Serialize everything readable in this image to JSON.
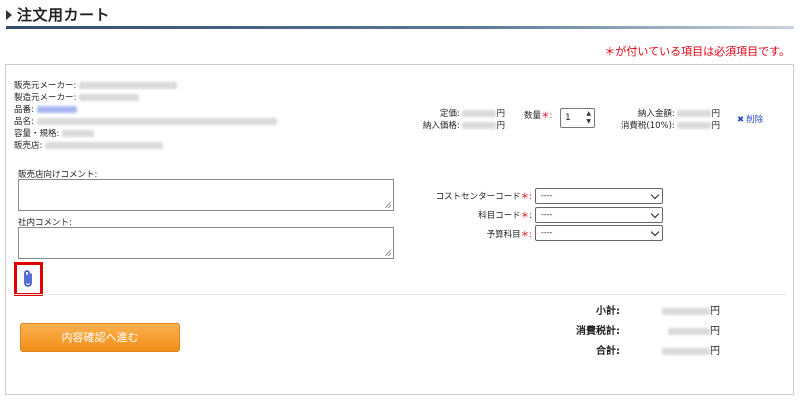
{
  "header": {
    "title": "注文用カート"
  },
  "required_note": "＊が付いている項目は必須項目です。",
  "product": {
    "seller_maker_label": "販売元メーカー:",
    "manufacturer_label": "製造元メーカー:",
    "part_number_label": "品番:",
    "product_name_label": "品名:",
    "capacity_spec_label": "容量・規格:",
    "store_label": "販売店:"
  },
  "pricing": {
    "list_price_label": "定価:",
    "delivery_price_label": "納入価格:",
    "currency_suffix": "円"
  },
  "quantity": {
    "label": "数量",
    "required_mark": "＊:",
    "value": "1"
  },
  "amounts": {
    "delivery_amount_label": "納入金額:",
    "consumption_tax_label": "消費税(10%):",
    "currency_suffix": "円"
  },
  "delete": {
    "icon_char": "✖",
    "label": "削除"
  },
  "comments": {
    "store_comment_label": "販売店向けコメント:",
    "internal_comment_label": "社内コメント:"
  },
  "fields": {
    "cost_center": {
      "label": "コストセンターコード",
      "required_mark": "＊:",
      "value": "----"
    },
    "account_code": {
      "label": "科目コード",
      "required_mark": "＊:",
      "value": "----"
    },
    "budget_item": {
      "label": "予算科目",
      "required_mark": "＊:",
      "value": "----"
    }
  },
  "icons": {
    "attachment": "paperclip-icon",
    "delete": "close-icon"
  },
  "totals": {
    "subtotal_label": "小計:",
    "tax_label": "消費税計:",
    "total_label": "合計:",
    "currency_suffix": "円"
  },
  "confirm_button": {
    "label": "内容確認へ進む"
  },
  "colors": {
    "accent_orange": "#f39c26",
    "required_red": "#e60012",
    "link_blue": "#2a4ec8",
    "highlight_red": "#e00000"
  }
}
